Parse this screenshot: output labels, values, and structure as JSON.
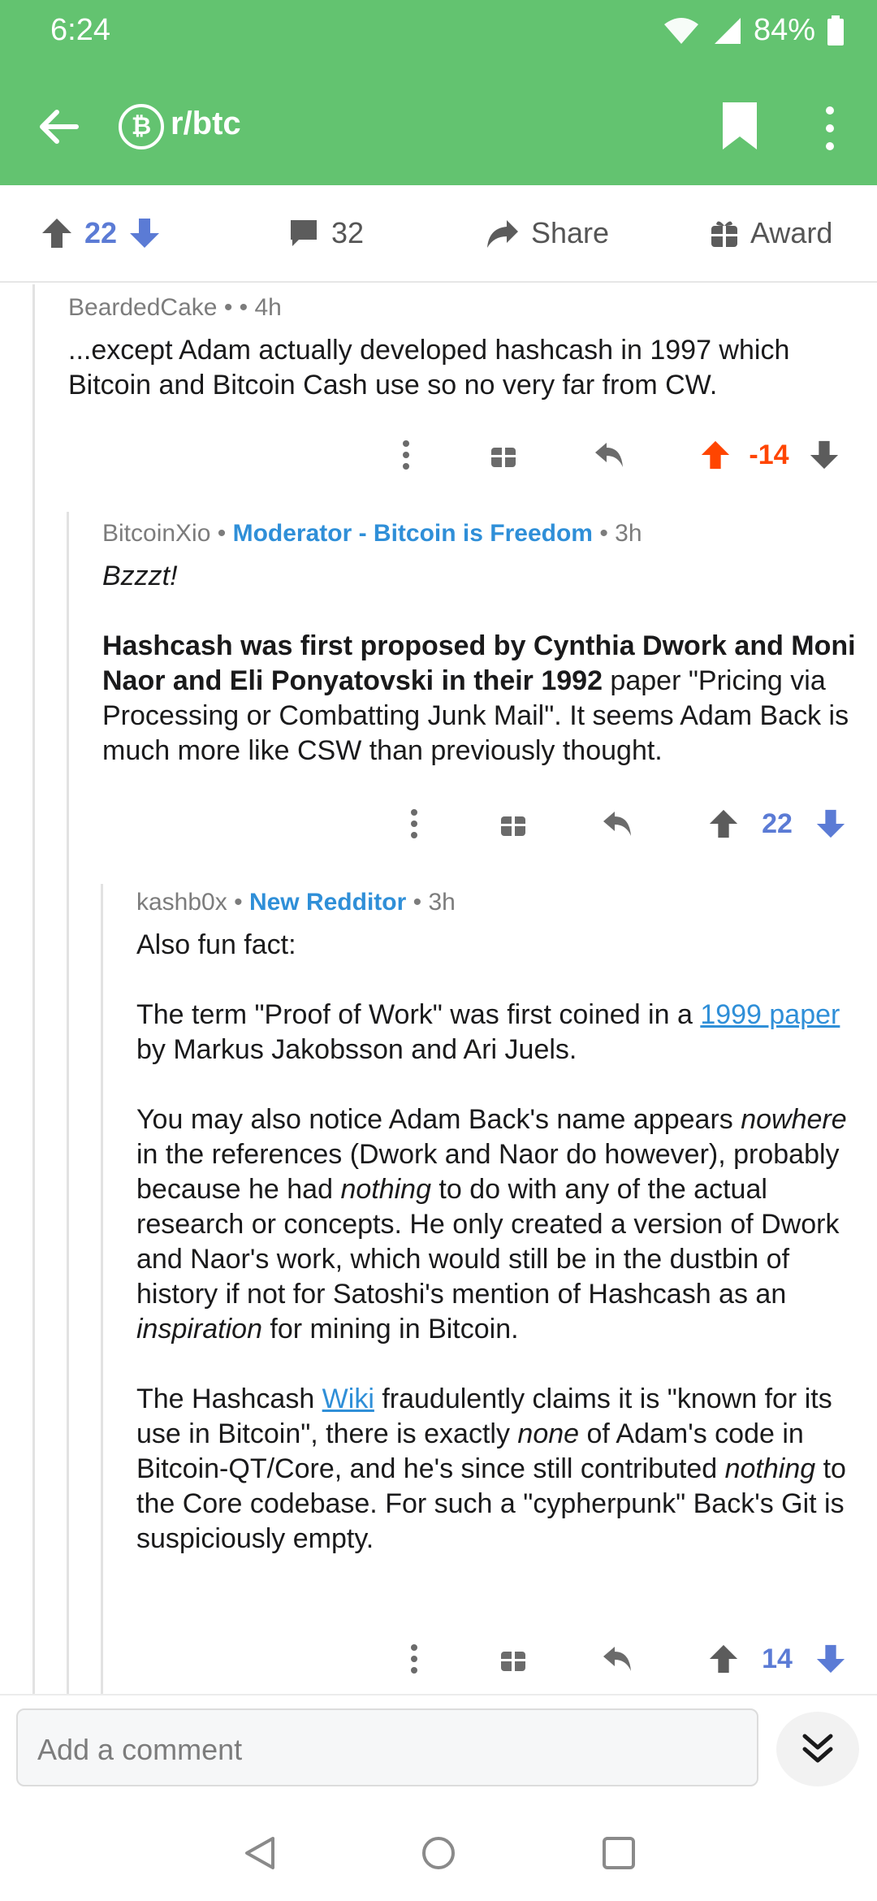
{
  "status_bar": {
    "time": "6:24",
    "battery": "84%"
  },
  "app_bar": {
    "subreddit": "r/btc",
    "subreddit_icon": "bitcoin-icon"
  },
  "post_bar": {
    "score": "22",
    "comments": "32",
    "share_label": "Share",
    "award_label": "Award"
  },
  "comments": [
    {
      "author": "BeardedCake",
      "flair": "",
      "age": "• 4h",
      "paragraphs": [
        "...except Adam actually developed hashcash in 1997 which Bitcoin and Bitcoin Cash use so no very far from CW."
      ],
      "score": "-14"
    },
    {
      "author": "BitcoinXio",
      "flair": "Moderator - Bitcoin is Freedom",
      "age": "3h",
      "p1": "Bzzzt!",
      "p2_bold": "Hashcash was first proposed by Cynthia Dwork and Moni Naor and Eli Ponyatovski in their 1992",
      "p2_rest": " paper \"Pricing via Processing or Combatting Junk Mail\". It seems Adam Back is much more like CSW than previously thought.",
      "score": "22"
    },
    {
      "author": "kashb0x",
      "flair": "New Redditor",
      "age": "3h",
      "p1": "Also fun fact:",
      "p2_a": "The term \"Proof of Work\" was first coined in a ",
      "p2_link": "1999 paper",
      "p2_b": " by Markus Jakobsson and Ari Juels.",
      "p3_a": "You may also notice Adam Back's name appears ",
      "p3_em1": "nowhere",
      "p3_b": " in the references (Dwork and Naor do however), probably because he had ",
      "p3_em2": "nothing",
      "p3_c": " to do with any of the actual research or concepts. He only created a version of Dwork and Naor's work, which would still be in the dustbin of history if not for Satoshi's mention of Hashcash as an ",
      "p3_em3": "inspiration",
      "p3_d": " for mining in Bitcoin.",
      "p4_a": "The Hashcash ",
      "p4_link": "Wiki",
      "p4_b": " fraudulently claims it is \"known for its use in Bitcoin\", there is exactly ",
      "p4_em1": "none",
      "p4_c": " of Adam's code in Bitcoin-QT/Core, and he's since still contributed ",
      "p4_em2": "nothing",
      "p4_d": " to the Core codebase. For such a \"cypherpunk\" Back's Git is suspiciously empty.",
      "score": "14"
    }
  ],
  "composer": {
    "placeholder": "Add a comment"
  },
  "colors": {
    "brand_green": "#63c370",
    "upvote_orange": "#ff4500",
    "vote_blue": "#5b7bd5",
    "flair_blue": "#2f8fd8"
  }
}
